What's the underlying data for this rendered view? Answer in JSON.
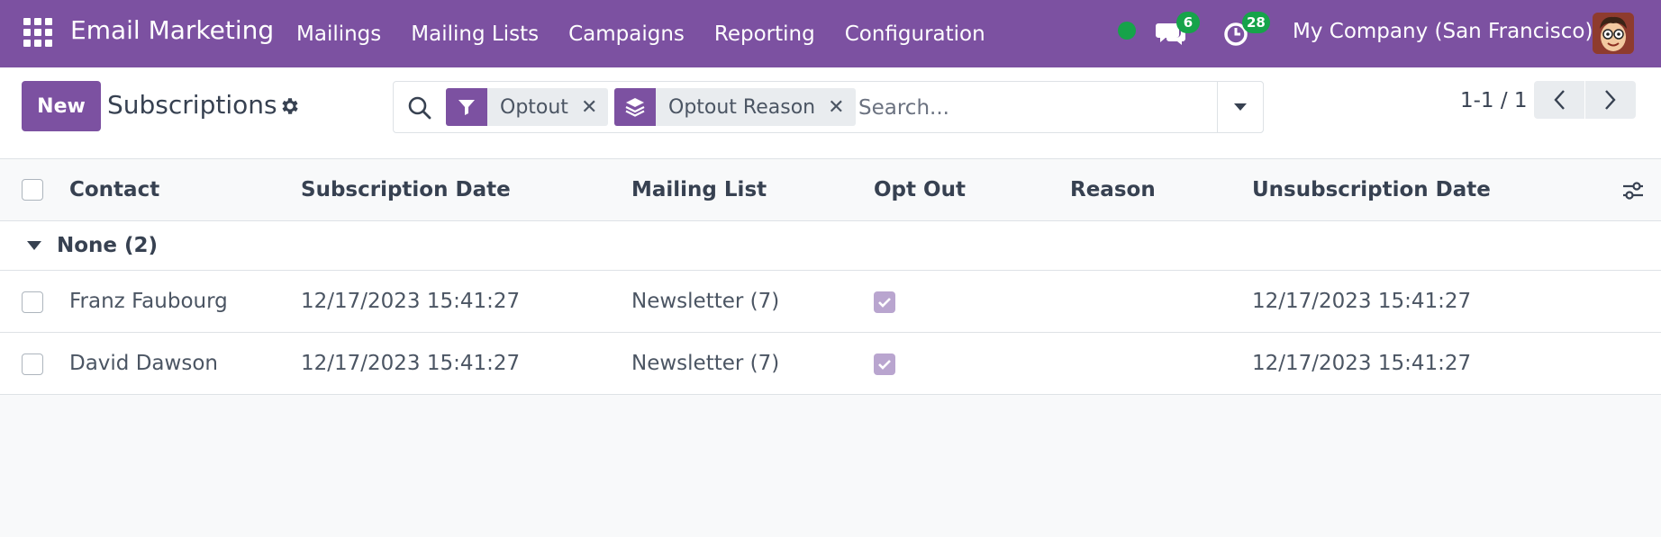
{
  "navbar": {
    "brand": "Email Marketing",
    "menu": [
      "Mailings",
      "Mailing Lists",
      "Campaigns",
      "Reporting",
      "Configuration"
    ],
    "chat_count": "6",
    "activity_count": "28",
    "company": "My Company (San Francisco)",
    "status_color": "#16a34a",
    "accent_color": "#7c51a1"
  },
  "control": {
    "new_label": "New",
    "title": "Subscriptions",
    "facets": [
      {
        "label": "Optout",
        "icon": "filter-icon"
      },
      {
        "label": "Optout Reason",
        "icon": "layers-icon"
      }
    ],
    "search_placeholder": "Search...",
    "pager": "1-1 / 1"
  },
  "table": {
    "columns": [
      "Contact",
      "Subscription Date",
      "Mailing List",
      "Opt Out",
      "Reason",
      "Unsubscription Date"
    ],
    "group_label": "None (2)",
    "rows": [
      {
        "contact": "Franz Faubourg",
        "subscription_date": "12/17/2023 15:41:27",
        "mailing_list": "Newsletter (7)",
        "opt_out": true,
        "reason": "",
        "unsubscription_date": "12/17/2023 15:41:27"
      },
      {
        "contact": "David Dawson",
        "subscription_date": "12/17/2023 15:41:27",
        "mailing_list": "Newsletter (7)",
        "opt_out": true,
        "reason": "",
        "unsubscription_date": "12/17/2023 15:41:27"
      }
    ]
  }
}
